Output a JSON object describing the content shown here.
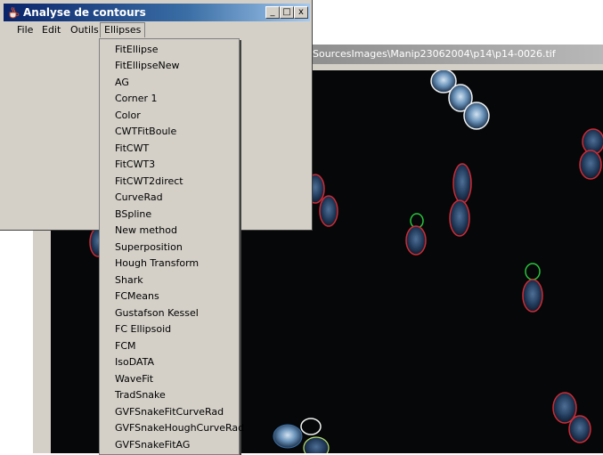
{
  "window": {
    "title": "Analyse de contours",
    "buttons": {
      "minimize": "_",
      "maximize": "□",
      "close": "x"
    }
  },
  "menubar": [
    "File",
    "Edit",
    "Outils",
    "Ellipses"
  ],
  "ellipses_menu": [
    "FitEllipse",
    "FitEllipseNew",
    "AG",
    "Corner 1",
    "Color",
    "CWTFitBoule",
    "FitCWT",
    "FitCWT3",
    "FitCWT2direct",
    "CurveRad",
    "BSpline",
    "New method",
    "Superposition",
    "Hough Transform",
    "Shark",
    "FCMeans",
    "Gustafson Kessel",
    "FC Ellipsoid",
    "FCM",
    "IsoDATA",
    "WaveFit",
    "TradSnake",
    "GVFSnakeFitCurveRad",
    "GVFSnakeHoughCurveRad",
    "GVFSnakeFitAG"
  ],
  "image_window": {
    "title": "SourcesImages\\Manip23062004\\p14\\p14-0026.tif"
  },
  "colors": {
    "titlebar_active": "#0a246a",
    "titlebar_inactive": "#8d8d8d",
    "window_face": "#d4d0c8",
    "contour_red": "#d02a35",
    "contour_green": "#28c43c",
    "contour_white": "#f2f2f2",
    "cell_fill": "#2c4c74"
  }
}
